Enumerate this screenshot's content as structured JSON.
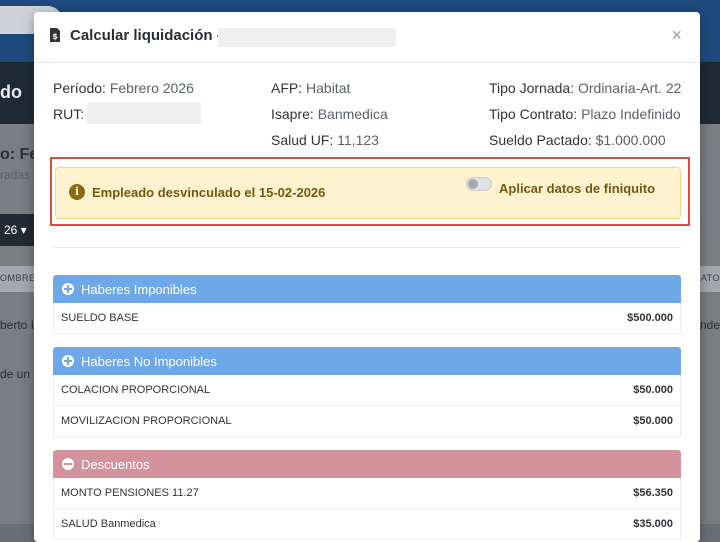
{
  "background": {
    "header_fragment": "do",
    "subtitle_fragment": "o: Feb",
    "subtitle2_fragment": "radas e",
    "dropdown_fragment": "26 ▾",
    "table_header_left": "OMBRE",
    "table_header_right": "RATO",
    "row1_left": "berto I",
    "row1_right": "Inde",
    "row2_left": "de un"
  },
  "modal": {
    "title": "Calcular liquidación -",
    "close_label": "×",
    "info": {
      "periodo_label": "Período:",
      "periodo_value": "Febrero 2026",
      "rut_label": "RUT:",
      "afp_label": "AFP:",
      "afp_value": "Habitat",
      "isapre_label": "Isapre:",
      "isapre_value": "Banmedica",
      "salud_label": "Salud UF:",
      "salud_value": "11,123",
      "jornada_label": "Tipo Jornada:",
      "jornada_value": "Ordinaria-Art. 22",
      "contrato_label": "Tipo Contrato:",
      "contrato_value": "Plazo Indefinido",
      "sueldo_label": "Sueldo Pactado:",
      "sueldo_value": "$1.000.000"
    },
    "alert": {
      "icon": "i",
      "message": "Empleado desvinculado el 15-02-2026",
      "toggle_label": "Aplicar datos de finiquito",
      "toggle_on": false
    },
    "sections": [
      {
        "title": "Haberes Imponibles",
        "rows": [
          {
            "label": "SUELDO BASE",
            "amount": "$500.000"
          }
        ]
      },
      {
        "title": "Haberes No Imponibles",
        "rows": [
          {
            "label": "COLACION PROPORCIONAL",
            "amount": "$50.000"
          },
          {
            "label": "MOVILIZACION PROPORCIONAL",
            "amount": "$50.000"
          }
        ]
      },
      {
        "title": "Descuentos",
        "rows": [
          {
            "label": "MONTO PENSIONES 11.27",
            "amount": "$56.350"
          },
          {
            "label": "SALUD Banmedica",
            "amount": "$35.000"
          }
        ]
      }
    ]
  }
}
